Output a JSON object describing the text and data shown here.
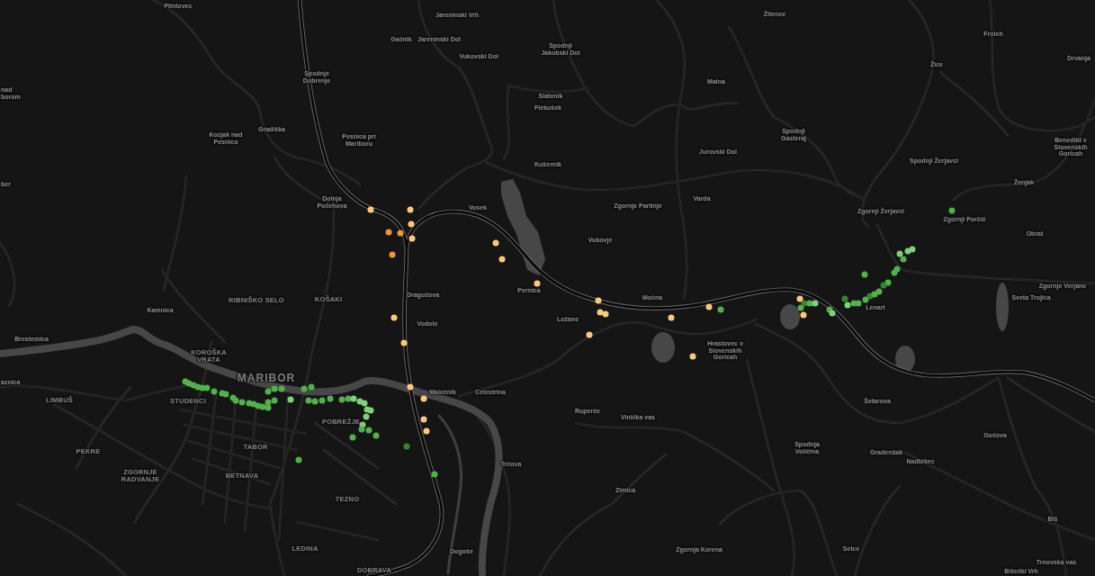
{
  "map": {
    "place_labels": [
      {
        "text": "Plintovec",
        "kind": "village"
      },
      {
        "text": "Jareninski Vrh",
        "kind": "village"
      },
      {
        "text": "Žitence",
        "kind": "village"
      },
      {
        "text": "Gačnik",
        "kind": "village"
      },
      {
        "text": "Jareninski Dol",
        "kind": "village"
      },
      {
        "text": "Froleh",
        "kind": "village"
      },
      {
        "text": "Spodnji Jakobski Dol",
        "kind": "village"
      },
      {
        "text": "Vukovski Dol",
        "kind": "village"
      },
      {
        "text": "Drvanja",
        "kind": "village"
      },
      {
        "text": "Žice",
        "kind": "village"
      },
      {
        "text": "Spodnje Dobrenje",
        "kind": "village"
      },
      {
        "text": "Malna",
        "kind": "village"
      },
      {
        "text": "nad borom",
        "kind": "village"
      },
      {
        "text": "Slatenik",
        "kind": "village"
      },
      {
        "text": "Flekušek",
        "kind": "village"
      },
      {
        "text": "Kozjak nad Pesnico",
        "kind": "village"
      },
      {
        "text": "Gradiška",
        "kind": "village"
      },
      {
        "text": "Pesnica pri Mariboru",
        "kind": "village"
      },
      {
        "text": "Spodnji Gasteraj",
        "kind": "village"
      },
      {
        "text": "Jurovski Dol",
        "kind": "village"
      },
      {
        "text": "Benedikt v Slovenskih Goricah",
        "kind": "village"
      },
      {
        "text": "Kušernik",
        "kind": "village"
      },
      {
        "text": "Spodnji Žerjavci",
        "kind": "village"
      },
      {
        "text": "ber",
        "kind": "village"
      },
      {
        "text": "Ženjak",
        "kind": "village"
      },
      {
        "text": "Dolnja Počehova",
        "kind": "village"
      },
      {
        "text": "Vosek",
        "kind": "village"
      },
      {
        "text": "Zgornje Partinje",
        "kind": "village"
      },
      {
        "text": "Varda",
        "kind": "village"
      },
      {
        "text": "Zgornji Žerjavci",
        "kind": "village"
      },
      {
        "text": "Zgornji Porčič",
        "kind": "village"
      },
      {
        "text": "Vukovje",
        "kind": "village"
      },
      {
        "text": "Obrat",
        "kind": "village"
      },
      {
        "text": "Pernica",
        "kind": "village"
      },
      {
        "text": "Zgornje Verjane",
        "kind": "village"
      },
      {
        "text": "RIBNIŠKO SELO",
        "kind": "district"
      },
      {
        "text": "KOŠAKI",
        "kind": "district"
      },
      {
        "text": "Dragučova",
        "kind": "village"
      },
      {
        "text": "Močna",
        "kind": "village"
      },
      {
        "text": "Sveta Trojica",
        "kind": "village"
      },
      {
        "text": "Kamnica",
        "kind": "village"
      },
      {
        "text": "Lenart",
        "kind": "village"
      },
      {
        "text": "Vodole",
        "kind": "village"
      },
      {
        "text": "Ložane",
        "kind": "village"
      },
      {
        "text": "Brestemica",
        "kind": "village"
      },
      {
        "text": "KOROŠKA VRATA",
        "kind": "district"
      },
      {
        "text": "Hrastovec v Slovenskih Goricah",
        "kind": "village"
      },
      {
        "text": "aznica",
        "kind": "village"
      },
      {
        "text": "MARIBOR",
        "kind": "city"
      },
      {
        "text": "Malečnik",
        "kind": "village"
      },
      {
        "text": "Celestrina",
        "kind": "village"
      },
      {
        "text": "LIMBUŠ",
        "kind": "district"
      },
      {
        "text": "STUDENCI",
        "kind": "district"
      },
      {
        "text": "Šetarova",
        "kind": "village"
      },
      {
        "text": "Ruperče",
        "kind": "village"
      },
      {
        "text": "POBREŽJE",
        "kind": "district"
      },
      {
        "text": "Vinička vas",
        "kind": "village"
      },
      {
        "text": "Gočova",
        "kind": "village"
      },
      {
        "text": "PEKRE",
        "kind": "district"
      },
      {
        "text": "TABOR",
        "kind": "district"
      },
      {
        "text": "Spodnja Voličina",
        "kind": "village"
      },
      {
        "text": "Gradenšak",
        "kind": "village"
      },
      {
        "text": "Trčova",
        "kind": "village"
      },
      {
        "text": "Nadbišec",
        "kind": "village"
      },
      {
        "text": "ZGORNJE RADVANJE",
        "kind": "district"
      },
      {
        "text": "BETNAVA",
        "kind": "district"
      },
      {
        "text": "Zimica",
        "kind": "village"
      },
      {
        "text": "TEZNO",
        "kind": "district"
      },
      {
        "text": "Biš",
        "kind": "village"
      },
      {
        "text": "LEDINA",
        "kind": "district"
      },
      {
        "text": "Dogoše",
        "kind": "village"
      },
      {
        "text": "Zgornja Korena",
        "kind": "village"
      },
      {
        "text": "Selce",
        "kind": "village"
      },
      {
        "text": "Trnovska vas",
        "kind": "village"
      },
      {
        "text": "DOBRAVA",
        "kind": "district"
      },
      {
        "text": "Bišečki Vrh",
        "kind": "village"
      }
    ],
    "markers": [
      {
        "color": "#ffc97b"
      },
      {
        "color": "#ffc97b"
      },
      {
        "color": "#ffc97b"
      },
      {
        "color": "#f5962a"
      },
      {
        "color": "#f5962a"
      },
      {
        "color": "#ffc97b"
      },
      {
        "color": "#f5962a"
      },
      {
        "color": "#ffc97b"
      },
      {
        "color": "#ffc97b"
      },
      {
        "color": "#ffc97b"
      },
      {
        "color": "#ffc97b"
      },
      {
        "color": "#ffc97b"
      },
      {
        "color": "#ffc97b"
      },
      {
        "color": "#ffc97b"
      },
      {
        "color": "#ffc97b"
      },
      {
        "color": "#ffc97b"
      },
      {
        "color": "#ffc97b"
      },
      {
        "color": "#ffc97b"
      },
      {
        "color": "#ffc97b"
      },
      {
        "color": "#ffc97b"
      },
      {
        "color": "#ffc97b"
      },
      {
        "color": "#ffc97b"
      },
      {
        "color": "#ffc97b"
      },
      {
        "color": "#ffc97b"
      },
      {
        "color": "#ffc97b"
      },
      {
        "color": "#52b14a"
      },
      {
        "color": "#52b14a"
      },
      {
        "color": "#2f8a2f"
      },
      {
        "color": "#52b14a"
      },
      {
        "color": "#7fd07a"
      },
      {
        "color": "#52b14a"
      },
      {
        "color": "#7fd07a"
      },
      {
        "color": "#2f8a2f"
      },
      {
        "color": "#7fd07a"
      },
      {
        "color": "#52b14a"
      },
      {
        "color": "#52b14a"
      },
      {
        "color": "#52b14a"
      },
      {
        "color": "#2f8a2f"
      },
      {
        "color": "#52b14a"
      },
      {
        "color": "#52b14a"
      },
      {
        "color": "#52b14a"
      },
      {
        "color": "#7fd07a"
      },
      {
        "color": "#7fd07a"
      },
      {
        "color": "#52b14a"
      },
      {
        "color": "#7fd07a"
      },
      {
        "color": "#52b14a"
      },
      {
        "color": "#52b14a"
      },
      {
        "color": "#52b14a"
      },
      {
        "color": "#2f8a2f"
      },
      {
        "color": "#52b14a"
      },
      {
        "color": "#52b14a"
      },
      {
        "color": "#52b14a"
      },
      {
        "color": "#52b14a"
      },
      {
        "color": "#52b14a"
      },
      {
        "color": "#52b14a"
      },
      {
        "color": "#52b14a"
      },
      {
        "color": "#52b14a"
      },
      {
        "color": "#52b14a"
      },
      {
        "color": "#52b14a"
      },
      {
        "color": "#52b14a"
      },
      {
        "color": "#52b14a"
      },
      {
        "color": "#52b14a"
      },
      {
        "color": "#52b14a"
      },
      {
        "color": "#52b14a"
      },
      {
        "color": "#52b14a"
      },
      {
        "color": "#52b14a"
      },
      {
        "color": "#52b14a"
      },
      {
        "color": "#52b14a"
      },
      {
        "color": "#52b14a"
      },
      {
        "color": "#52b14a"
      },
      {
        "color": "#52b14a"
      },
      {
        "color": "#52b14a"
      },
      {
        "color": "#7fd07a"
      },
      {
        "color": "#52b14a"
      },
      {
        "color": "#52b14a"
      },
      {
        "color": "#52b14a"
      },
      {
        "color": "#52b14a"
      },
      {
        "color": "#52b14a"
      },
      {
        "color": "#52b14a"
      },
      {
        "color": "#52b14a"
      },
      {
        "color": "#52b14a"
      },
      {
        "color": "#7fd07a"
      },
      {
        "color": "#7fd07a"
      },
      {
        "color": "#7fd07a"
      },
      {
        "color": "#7fd07a"
      },
      {
        "color": "#7fd07a"
      },
      {
        "color": "#7fd07a"
      },
      {
        "color": "#7fd07a"
      },
      {
        "color": "#52b14a"
      },
      {
        "color": "#52b14a"
      },
      {
        "color": "#52b14a"
      },
      {
        "color": "#52b14a"
      },
      {
        "color": "#52b14a"
      },
      {
        "color": "#2f8a2f"
      },
      {
        "color": "#52b14a"
      }
    ]
  }
}
